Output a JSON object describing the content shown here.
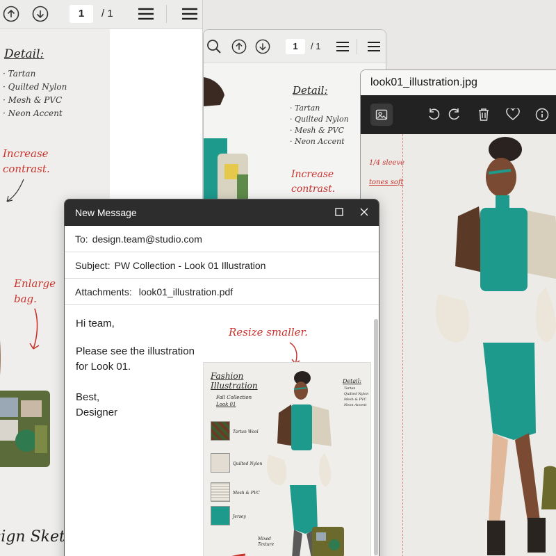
{
  "pdf_back": {
    "page_current": "1",
    "page_total": "/ 1",
    "detail_title": "Detail:",
    "details": [
      "· Tartan",
      "· Quilted Nylon",
      "· Mesh & PVC",
      "· Neon Accent"
    ],
    "note_contrast": "Increase contrast.",
    "note_bag": "Enlarge bag.",
    "footer_text": "sign Sketch"
  },
  "pdf_middle": {
    "page_current": "1",
    "page_total": "/ 1",
    "detail_title": "Detail:",
    "details": [
      "· Tartan",
      "· Quilted Nylon",
      "· Mesh & PVC",
      "· Neon Accent"
    ],
    "note_contrast": "Increase contrast."
  },
  "image_viewer": {
    "title": "look01_illustration.jpg",
    "scribble_1": "1/4 sleeve",
    "scribble_2": "tones soft"
  },
  "compose": {
    "header": "New Message",
    "to_label": "To:",
    "to_value": "design.team@studio.com",
    "subject_label": "Subject:",
    "subject_value": "PW Collection - Look 01 Illustration",
    "attach_label": "Attachments:",
    "attach_value": "look01_illustration.pdf",
    "greeting": "Hi team,",
    "body_line1": "Please see the illustration",
    "body_line2": "for Look 01.",
    "signoff": "Best,",
    "signature": "Designer",
    "annotation": "Resize smaller.",
    "preview": {
      "title": "Fashion Illustration",
      "collection": "Fall Collection",
      "look": "Look 01",
      "detail_title": "Detail:",
      "details": [
        "Tartan",
        "Quilted Nylon",
        "Mesh & PVC",
        "Neon Accent"
      ],
      "swatches": [
        "Tartan Wool",
        "Quilted Nylon",
        "Mesh & PVC",
        "Jersey"
      ],
      "mixed": "Mixed Texture"
    }
  },
  "colors": {
    "teal": "#1e9a8c",
    "annotation_red": "#c8332c",
    "dark_titlebar": "#2d2d2d"
  }
}
